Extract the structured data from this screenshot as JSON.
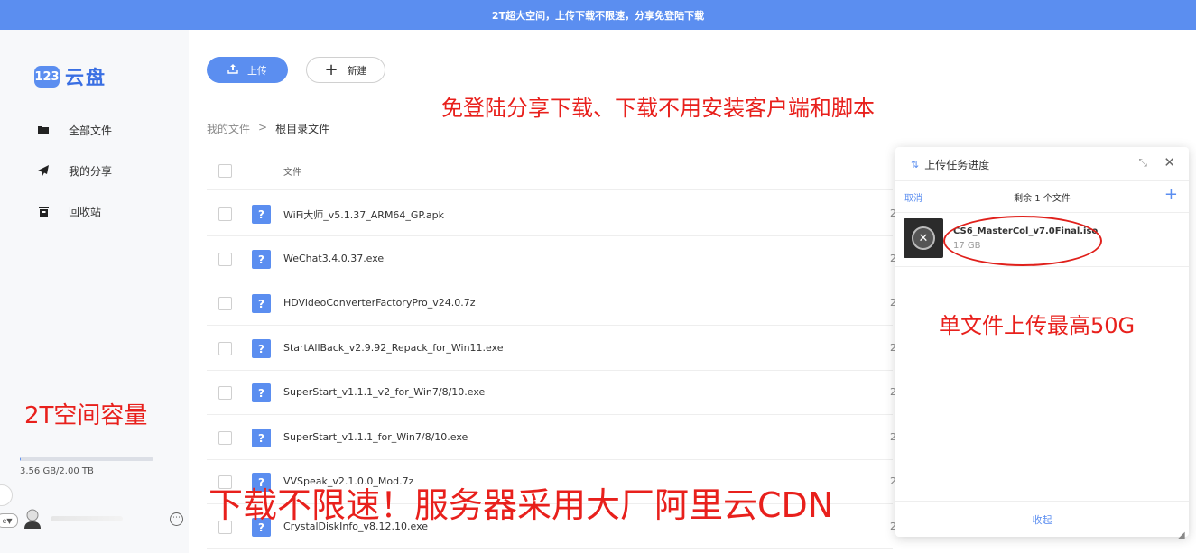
{
  "banner": {
    "text": "2T超大空间，上传下载不限速，分享免登陆下载"
  },
  "logo": {
    "badge": "123",
    "text": "云盘"
  },
  "sidebar": {
    "items": [
      {
        "label": "全部文件",
        "icon": "folder-icon"
      },
      {
        "label": "我的分享",
        "icon": "share-icon"
      },
      {
        "label": "回收站",
        "icon": "trash-icon"
      }
    ],
    "storage": {
      "used_text": "3.56 GB/2.00 TB",
      "used_fraction": 0.0017
    },
    "lang_label": "e▼",
    "more_icon": "⋯"
  },
  "toolbar": {
    "upload_label": "上传",
    "new_label": "新建"
  },
  "breadcrumb": {
    "root": "我的文件",
    "separator": ">",
    "current": "根目录文件"
  },
  "table": {
    "header": "文件",
    "rows": [
      {
        "name": "WiFi大师_v5.1.37_ARM64_GP.apk",
        "cut": "2"
      },
      {
        "name": "WeChat3.4.0.37.exe",
        "cut": "2"
      },
      {
        "name": "HDVideoConverterFactoryPro_v24.0.7z",
        "cut": "2"
      },
      {
        "name": "StartAllBack_v2.9.92_Repack_for_Win11.exe",
        "cut": "2"
      },
      {
        "name": "SuperStart_v1.1.1_v2_for_Win7/8/10.exe",
        "cut": "2"
      },
      {
        "name": "SuperStart_v1.1.1_for_Win7/8/10.exe",
        "cut": "2"
      },
      {
        "name": "VVSpeak_v2.1.0.0_Mod.7z",
        "cut": "2"
      },
      {
        "name": "CrystalDiskInfo_v8.12.10.exe",
        "cut": "2"
      }
    ]
  },
  "annotations": {
    "top": "免登陆分享下载、下载不用安装客户端和脚本",
    "left": "2T空间容量",
    "bottom": "下载不限速！服务器采用大厂阿里云CDN",
    "panel": "单文件上传最高50G"
  },
  "upload_panel": {
    "title": "上传任务进度",
    "cancel_label": "取消",
    "remaining": "剩余 1 个文件",
    "task": {
      "name": "CS6_MasterCol_v7.0Final.iso",
      "size": "17 GB"
    },
    "collapse_label": "收起"
  },
  "colors": {
    "accent": "#5b8ef0",
    "annotation": "#e8201c"
  }
}
